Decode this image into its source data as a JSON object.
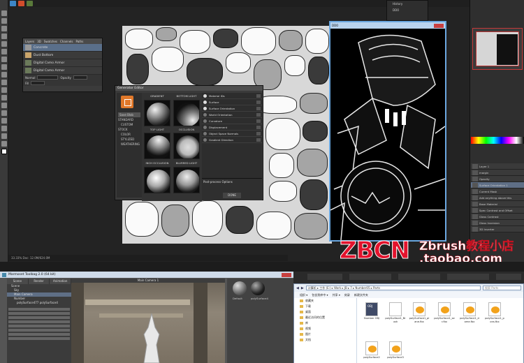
{
  "photoshop": {
    "layers_panel": {
      "tabs": [
        "Layers",
        "3D",
        "Swatches",
        "Channels",
        "Paths"
      ],
      "rows": [
        {
          "label": "Concrete",
          "selected": true
        },
        {
          "label": "Dust Bottom",
          "selected": false
        },
        {
          "label": "Digital Camo Armor",
          "selected": false
        },
        {
          "label": "Digital Camo Armor",
          "selected": false
        }
      ],
      "blend_mode": "Normal",
      "opacity_label": "Opacity",
      "fill_label": "Fill"
    },
    "generator": {
      "title": "Generator Editor",
      "side_button": "Save Blob",
      "side_items": [
        "STANDARD",
        "CUSTOM",
        "STOCK",
        "COLOR",
        "STYLIZED",
        "WEATHERING"
      ],
      "grid_captions": [
        "GRADIENT",
        "BOTTOM LIGHT",
        "TOP LIGHT",
        "OCCLUSION",
        "INCH OCCLUSION",
        "BLURRED LIGHT"
      ],
      "list_items": [
        "Material IDs",
        "Surface",
        "Surface Orientation",
        "World Orientation",
        "Curvature",
        "Displacement",
        "Object Space Normals",
        "Gradient Direction"
      ],
      "post_title": "Post-process Options",
      "done_label": "DONE"
    },
    "preview": {
      "title": "DDO"
    },
    "right_panel": {
      "history_labels": [
        "History",
        "DDO"
      ],
      "layers": [
        {
          "label": "Layer 1",
          "hl": false
        },
        {
          "label": "margin",
          "hl": false
        },
        {
          "label": "Opacity",
          "hl": false
        },
        {
          "label": "Surface Orientation 1",
          "hl": true
        },
        {
          "label": "Current Mask",
          "hl": false
        },
        {
          "label": "Add anything above this",
          "hl": false
        },
        {
          "label": "Base Material",
          "hl": false
        },
        {
          "label": "Spec Contrast and Offset",
          "hl": false
        },
        {
          "label": "Gloss Contrast",
          "hl": false
        },
        {
          "label": "Gloss Inversion",
          "hl": false
        },
        {
          "label": "3D Inverter",
          "hl": false
        }
      ]
    },
    "status": "33.33%   Doc: 12.0M/624.0M"
  },
  "watermark": {
    "brand": "ZBCN",
    "line1": "Zbrush教程小店",
    "line2": ".taobao.com"
  },
  "marmoset": {
    "title": "Marmoset Toolbag 2.0 (64 bit)",
    "tabs": [
      "Scene",
      "Render",
      "Animation"
    ],
    "tree": [
      "Scene",
      "Sky",
      "Main Camera",
      "Number",
      "polySurface477 polySurface4"
    ],
    "viewport_label": "Main Camera 1",
    "materials": [
      "Default",
      "polySurface4"
    ]
  },
  "explorer": {
    "path": "计算机 ▸ 工作 (E:) ▸ Work ▸ JB ▸ 7 ▸ Number05 ▸ Parts",
    "search_placeholder": "搜索 Parts",
    "commands": [
      "组织 ▾",
      "包含到库中 ▾",
      "共享 ▾",
      "刻录",
      "新建文件夹"
    ],
    "nav": [
      "收藏夹",
      "下载",
      "桌面",
      "最近访问的位置",
      "库",
      "视频",
      "图片",
      "文档"
    ],
    "files": [
      {
        "name": "Number OBJ",
        "kind": "obj"
      },
      {
        "name": "polySurface1_Br ush",
        "kind": "blank"
      },
      {
        "name": "polySurface1_pl ane.fbx",
        "kind": "fbx"
      },
      {
        "name": "polySurface1_se r.fbx",
        "kind": "fbx"
      },
      {
        "name": "polySurface1_d  ome.fbx",
        "kind": "fbx"
      },
      {
        "name": "polySurface1_p  ons.fbx",
        "kind": "fbx"
      },
      {
        "name": "polySurface2",
        "kind": "fbx"
      },
      {
        "name": "polySurface3",
        "kind": "fbx"
      }
    ]
  },
  "colors": {
    "accent": "#e3132d",
    "ps_bg": "#2b2b2b",
    "selection": "#5f6f86",
    "generator_logo": "#e0782a"
  }
}
